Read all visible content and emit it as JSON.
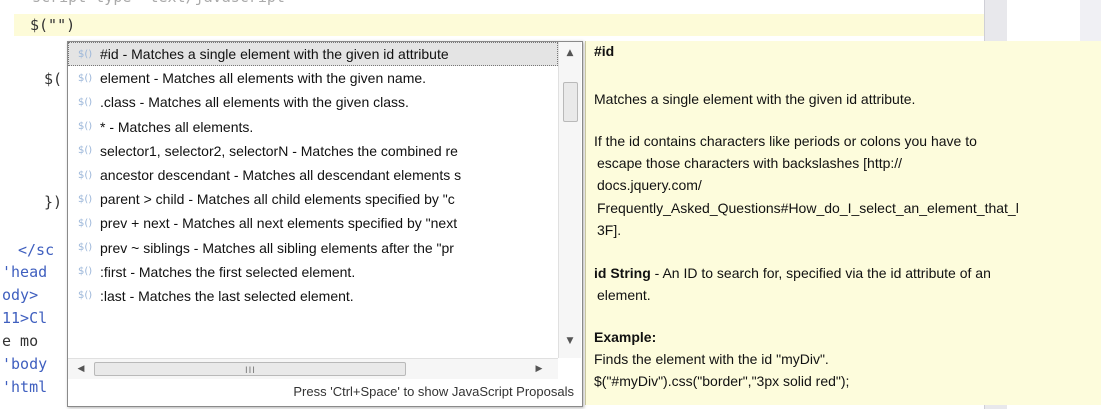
{
  "editor": {
    "lines": [
      {
        "text": "$(\"\")"
      },
      {
        "text": "$("
      },
      {
        "text": "})"
      },
      {
        "text": "</sc"
      },
      {
        "text": "'head"
      },
      {
        "text": "ody>"
      },
      {
        "text": "11>Cl"
      },
      {
        "text": "e mo"
      },
      {
        "text": "'body"
      },
      {
        "text": "'html"
      }
    ]
  },
  "proposals": {
    "icon": "$()",
    "items": [
      "#id - Matches a single element with the given id attribute",
      "element - Matches all elements with the given name.",
      ".class - Matches all elements with the given class.",
      "* - Matches all elements.",
      "selector1, selector2, selectorN - Matches the combined re",
      "ancestor descendant - Matches all descendant elements s",
      "parent > child - Matches all child elements specified by \"c",
      "prev + next - Matches all next elements specified by \"next",
      "prev ~ siblings - Matches all sibling elements after the \"pr",
      ":first - Matches the first selected element.",
      ":last - Matches the last selected element."
    ],
    "status": "Press 'Ctrl+Space' to show JavaScript Proposals",
    "hscroll_grip": "III"
  },
  "info": {
    "title": "#id",
    "desc": "Matches a single element with the given id attribute.",
    "para_lines": [
      "If the id contains characters like periods or colons you have to",
      "escape those characters with backslashes [http://",
      "docs.jquery.com/",
      "Frequently_Asked_Questions#How_do_I_select_an_element_that_l",
      "3F]."
    ],
    "param_name": "id String",
    "param_desc_1": " - An ID to search for, specified via the id attribute of an",
    "param_desc_2": "element.",
    "example_heading": "Example:",
    "example_desc": "Finds the element with the id \"myDiv\".",
    "example_code": "$(\"#myDiv\").css(\"border\",\"3px solid red\");"
  }
}
